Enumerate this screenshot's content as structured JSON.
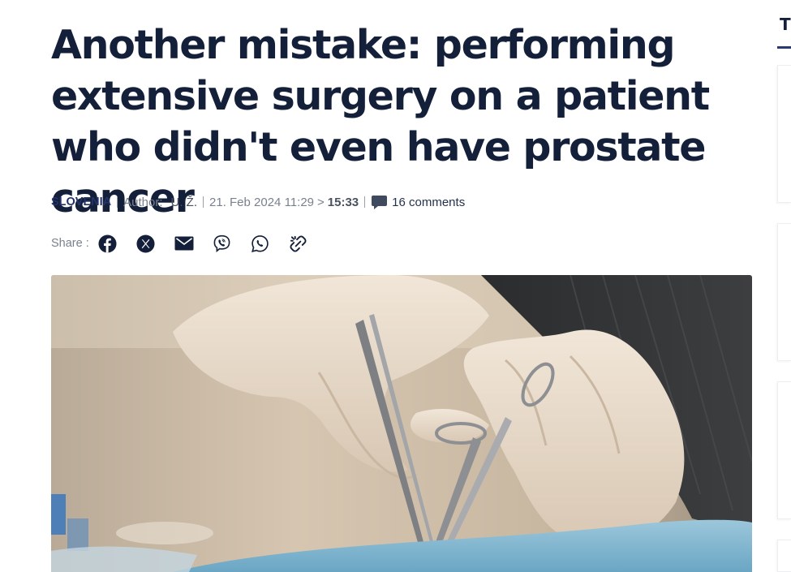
{
  "article": {
    "title": "Another mistake: performing extensive surgery on a patient who didn't even have prostate cancer",
    "category": "SLOVENIA",
    "author_label": "Author:",
    "author_name": "U. Ž.",
    "date": "21. Feb 2024",
    "published_time": "11:29",
    "time_separator": ">",
    "updated_time": "15:33",
    "comments": "16 comments"
  },
  "share": {
    "label": "Share :",
    "buttons": [
      {
        "name": "facebook",
        "icon": "facebook-icon"
      },
      {
        "name": "x",
        "icon": "x-icon"
      },
      {
        "name": "email",
        "icon": "mail-icon"
      },
      {
        "name": "viber",
        "icon": "viber-icon"
      },
      {
        "name": "whatsapp",
        "icon": "whatsapp-icon"
      },
      {
        "name": "copy-link",
        "icon": "link-icon"
      }
    ]
  },
  "hero_image": {
    "subject": "gloved hands holding surgical instruments during an operation"
  },
  "sidebar": {
    "title_partial": "T"
  },
  "colors": {
    "headline": "#14203a",
    "category": "#24326a",
    "meta_text": "#7a818d",
    "icon": "#14203a",
    "sidebar_accent": "#2a3a6e"
  }
}
